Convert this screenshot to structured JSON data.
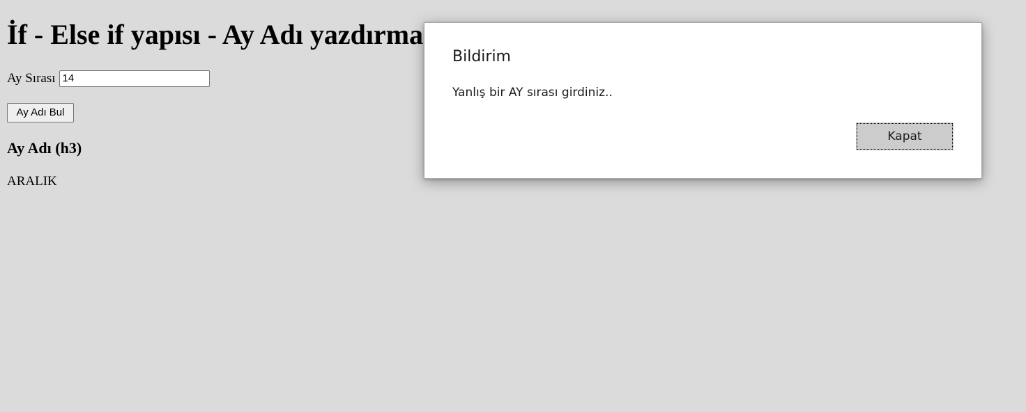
{
  "page": {
    "title": "İf - Else if yapısı - Ay Adı yazdırma",
    "field_label": "Ay Sırası",
    "field_value": "14",
    "button_label": "Ay Adı Bul",
    "result_heading": "Ay Adı (h3)",
    "result_value": "ARALIK"
  },
  "dialog": {
    "title": "Bildirim",
    "message": "Yanlış bir AY sırası girdiniz..",
    "close_label": "Kapat"
  },
  "colors": {
    "page_background": "#dbdbdb",
    "dialog_background": "#ffffff",
    "dialog_button": "#cccccc"
  }
}
